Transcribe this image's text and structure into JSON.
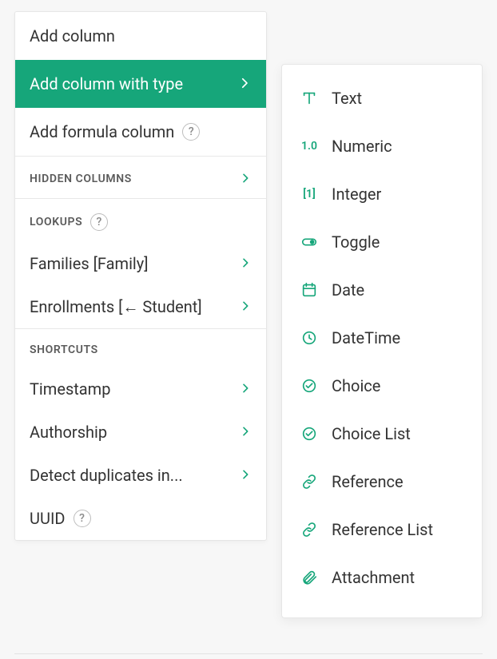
{
  "menu": {
    "add_column": "Add column",
    "add_column_with_type": "Add column with type",
    "add_formula_column": "Add formula column"
  },
  "sections": {
    "hidden_columns": "HIDDEN COLUMNS",
    "lookups": "LOOKUPS",
    "shortcuts": "SHORTCUTS"
  },
  "lookups": [
    {
      "label": "Families [Family]"
    },
    {
      "label": "Enrollments [← Student]"
    }
  ],
  "shortcuts": [
    {
      "label": "Timestamp",
      "has_chevron": true,
      "has_help": false
    },
    {
      "label": "Authorship",
      "has_chevron": true,
      "has_help": false
    },
    {
      "label": "Detect duplicates in...",
      "has_chevron": true,
      "has_help": false
    },
    {
      "label": "UUID",
      "has_chevron": false,
      "has_help": true
    }
  ],
  "column_types": [
    {
      "label": "Text",
      "icon": "text"
    },
    {
      "label": "Numeric",
      "icon": "numeric"
    },
    {
      "label": "Integer",
      "icon": "integer"
    },
    {
      "label": "Toggle",
      "icon": "toggle"
    },
    {
      "label": "Date",
      "icon": "date"
    },
    {
      "label": "DateTime",
      "icon": "datetime"
    },
    {
      "label": "Choice",
      "icon": "choice"
    },
    {
      "label": "Choice List",
      "icon": "choice"
    },
    {
      "label": "Reference",
      "icon": "reference"
    },
    {
      "label": "Reference List",
      "icon": "reference"
    },
    {
      "label": "Attachment",
      "icon": "attachment"
    }
  ],
  "glyphs": {
    "help": "?",
    "numeric": "1.0",
    "integer": "[1]"
  },
  "colors": {
    "accent": "#16a67a"
  }
}
